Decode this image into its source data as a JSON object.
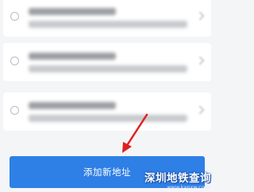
{
  "address_list": [
    {
      "selected": false,
      "content": "blurred"
    },
    {
      "selected": false,
      "content": "blurred"
    },
    {
      "selected": false,
      "content": "blurred"
    }
  ],
  "add_button": {
    "label": "添加新地址",
    "color": "#2e7fe6"
  },
  "annotation": {
    "arrow_color": "#e02020"
  },
  "watermark": {
    "title": "深圳地铁查询",
    "url": "www.kanxw.com"
  }
}
